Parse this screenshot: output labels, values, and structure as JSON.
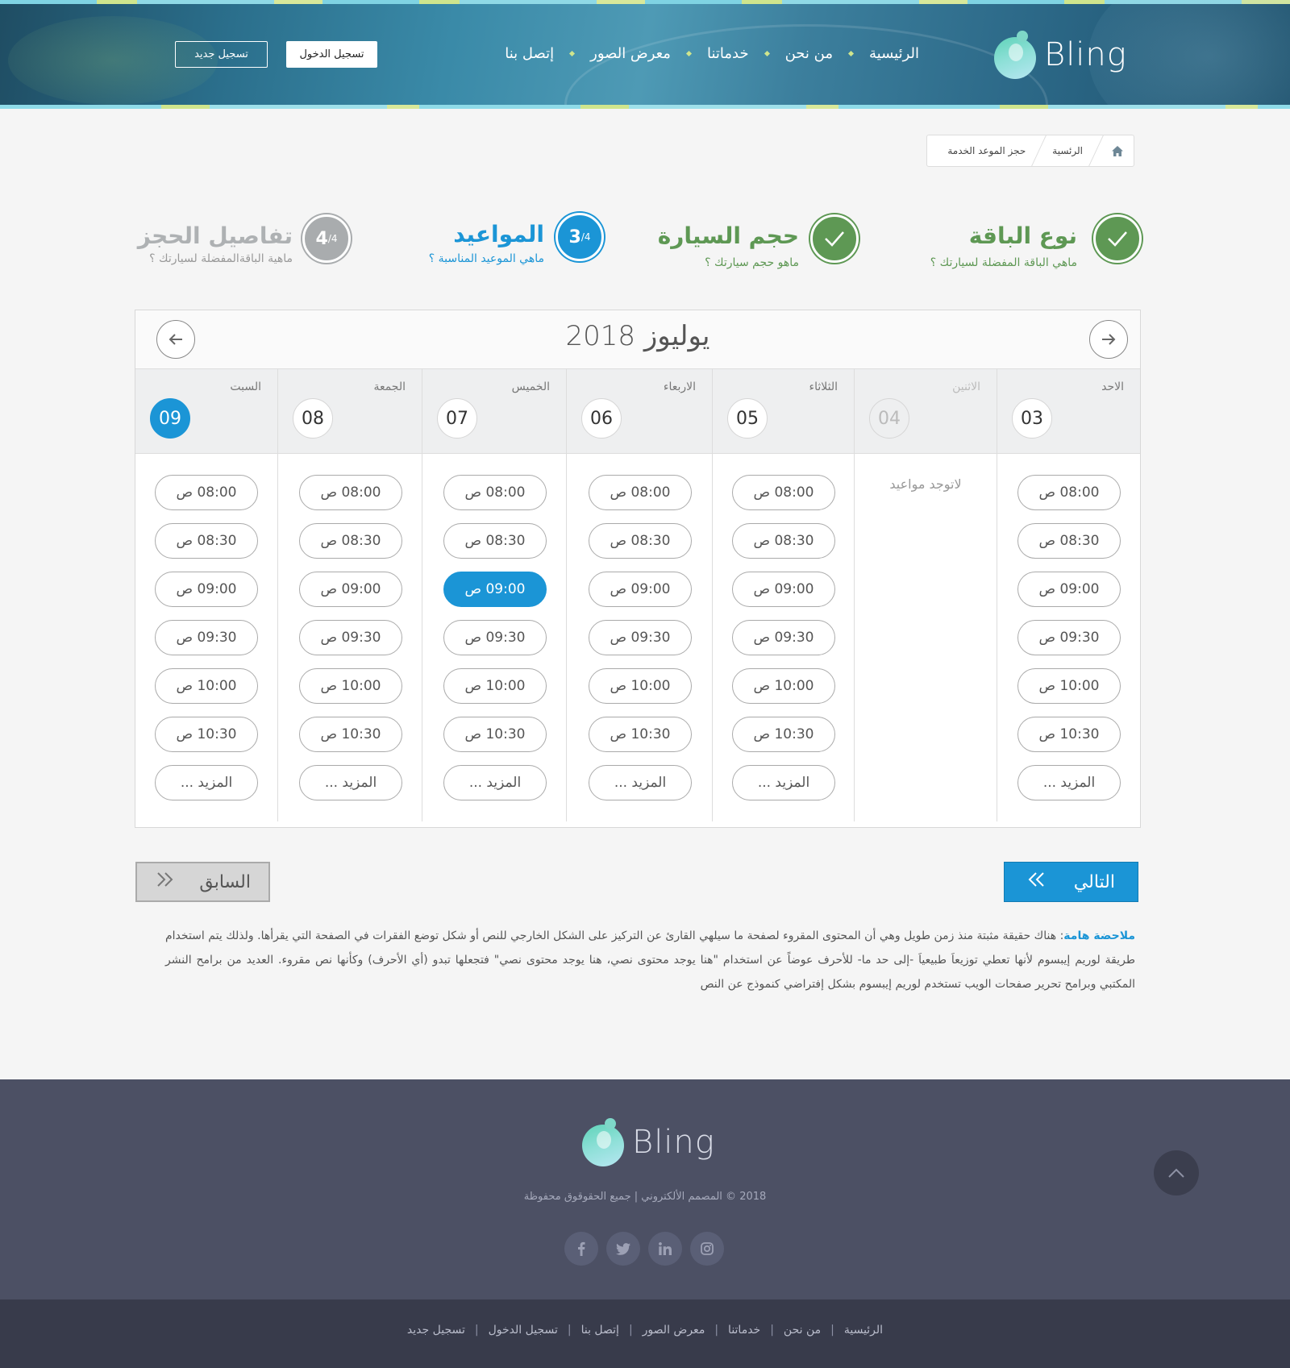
{
  "header": {
    "logo_text": "Bling",
    "nav": [
      "الرئيسية",
      "من نحن",
      "خدماتنا",
      "معرض الصور",
      "إتصل بنا"
    ],
    "login_label": "تسجيل الدخول",
    "register_label": "تسجيل جديد"
  },
  "breadcrumb": {
    "home": "الرئسية",
    "current": "حجز الموعد الخدمة"
  },
  "steps": [
    {
      "status": "done",
      "title": "نوع الباقة",
      "subtitle": "ماهي الباقة المفضلة لسيارتك ؟",
      "icon": "check-icon"
    },
    {
      "status": "done",
      "title": "حجم السيارة",
      "subtitle": "ماهو حجم سيارتك ؟",
      "icon": "check-icon"
    },
    {
      "status": "active",
      "title": "المواعيد",
      "subtitle": "ماهي الموعيد المناسبة ؟",
      "num": "3",
      "den": "/4"
    },
    {
      "status": "pending",
      "title": "تفاصيل الحجز",
      "subtitle": "ماهية الباقةالمفضلة لسيارتك ؟",
      "num": "4",
      "den": "/4"
    }
  ],
  "calendar": {
    "month_title": "يوليوز 2018",
    "days": [
      {
        "name": "الاحد",
        "num": "03",
        "state": "normal"
      },
      {
        "name": "الاثنين",
        "num": "04",
        "state": "disabled"
      },
      {
        "name": "الثلاثاء",
        "num": "05",
        "state": "normal"
      },
      {
        "name": "الاربعاء",
        "num": "06",
        "state": "normal"
      },
      {
        "name": "الخميس",
        "num": "07",
        "state": "normal"
      },
      {
        "name": "الجمعة",
        "num": "08",
        "state": "normal"
      },
      {
        "name": "السبت",
        "num": "09",
        "state": "active"
      }
    ],
    "slots": [
      "08:00 ص",
      "08:30 ص",
      "09:00 ص",
      "09:30 ص",
      "10:00 ص",
      "10:30 ص",
      "المزيد ..."
    ],
    "no_slots_text": "لاتوجد مواعيد",
    "selected_day": "07",
    "selected_slot": "09:00 ص"
  },
  "buttons": {
    "next": "التالي",
    "prev": "السابق"
  },
  "note": {
    "label": "ملاحضة هامة",
    "text": "هناك حقيقة مثبتة منذ زمن طويل وهي أن المحتوى المقروء لصفحة ما سيلهي القارئ عن التركيز على الشكل الخارجي للنص أو شكل توضع الفقرات في الصفحة التي يقرأها. ولذلك يتم استخدام طريقة لوريم إيبسوم لأنها تعطي توزيعاَ طبيعياَ -إلى حد ما- للأحرف عوضاً عن استخدام \"هنا يوجد محتوى نصي، هنا يوجد محتوى نصي\" فتجعلها تبدو (أي الأحرف) وكأنها نص مقروء. العديد من برامح النشر المكتبي وبرامح تحرير صفحات الويب تستخدم لوريم إيبسوم بشكل إفتراضي كنموذج عن النص"
  },
  "footer": {
    "logo_text": "Bling",
    "copyright": "2018 © المصمم الألكتروني | جميع الحقوقوق محفوظة",
    "socials": [
      "facebook-icon",
      "twitter-icon",
      "linkedin-icon",
      "instagram-icon"
    ],
    "links": [
      "الرئيسية",
      "من نحن",
      "خدماتنا",
      "معرض الصور",
      "إتصل بنا",
      "تسجيل الدخول",
      "تسجيل جديد"
    ]
  }
}
